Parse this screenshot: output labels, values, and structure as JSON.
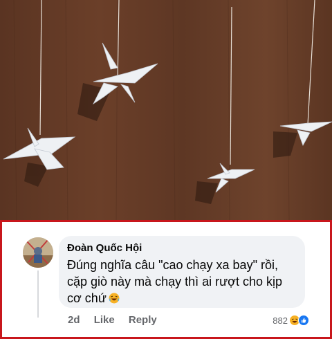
{
  "comment": {
    "author": "Đoàn Quốc Hội",
    "text": "Đúng nghĩa câu \"cao chạy xa bay\" rồi, cặp giò này mà chạy thì ai rượt cho kịp cơ chứ",
    "time": "2d",
    "like_label": "Like",
    "reply_label": "Reply",
    "reaction_count": "882",
    "reaction_icons": [
      "haha-icon",
      "like-icon"
    ]
  },
  "colors": {
    "frame_border": "#c8171c",
    "bubble_bg": "#f0f2f5",
    "meta_text": "#65676b",
    "like_blue": "#1877f2",
    "haha_yellow": "#f7b125"
  }
}
